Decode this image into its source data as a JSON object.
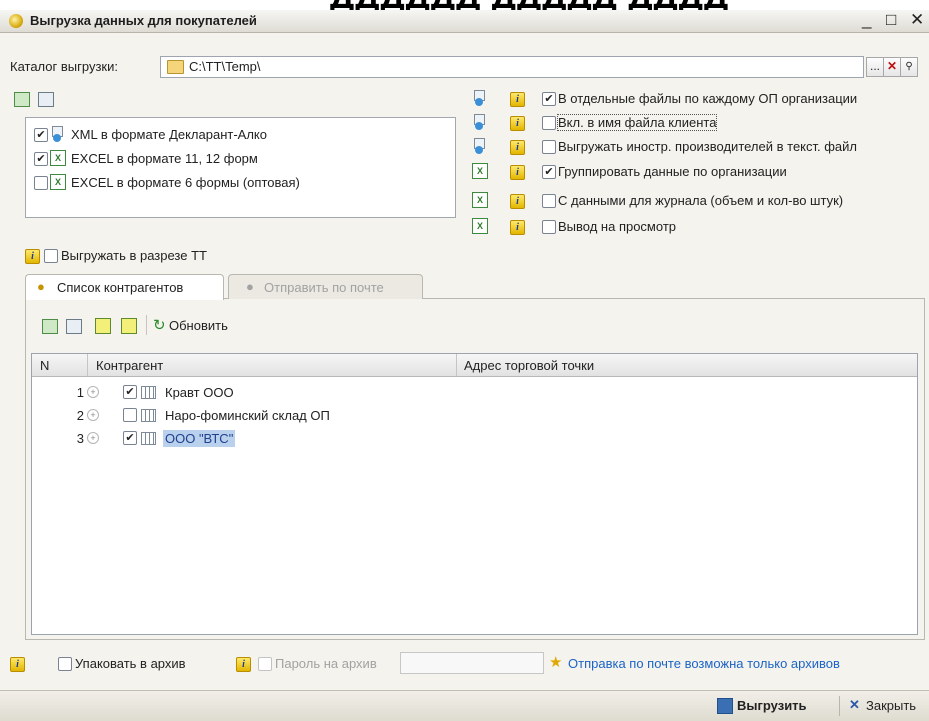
{
  "background_caption": "ДДДДДД ДДДДД ДДДД",
  "window": {
    "title": "Выгрузка данных для покупателей",
    "controls": {
      "minimize": "_",
      "maximize": "□",
      "close": "✕"
    }
  },
  "catalog": {
    "label": "Каталог выгрузки:",
    "path": "C:\\TT\\Temp\\",
    "select_btn": "...",
    "clear_btn": "✕",
    "open_btn": "🔍"
  },
  "formats": [
    {
      "label": "XML в формате Декларант-Алко",
      "checked": true,
      "icon": "xml-icon"
    },
    {
      "label": "EXCEL в формате 11, 12 форм",
      "checked": true,
      "icon": "excel-icon"
    },
    {
      "label": "EXCEL в формате 6 формы (оптовая)",
      "checked": false,
      "icon": "excel-icon"
    }
  ],
  "options": [
    {
      "label": "В отдельные файлы по каждому ОП организации",
      "checked": true,
      "icon": "xml-icon"
    },
    {
      "label": "Вкл. в имя файла клиента",
      "checked": false,
      "icon": "xml-icon"
    },
    {
      "label": "Выгружать иностр. производителей в текст. файл",
      "checked": false,
      "icon": "xml-icon"
    },
    {
      "label": "Группировать данные по организации",
      "checked": true,
      "icon": "excel-icon"
    },
    {
      "label": "С данными для журнала (объем и кол-во штук)",
      "checked": false,
      "icon": "excel-icon"
    },
    {
      "label": "Вывод на просмотр",
      "checked": false,
      "icon": "excel-icon"
    }
  ],
  "by_tt": {
    "label": "Выгружать в разрезе ТТ",
    "checked": false
  },
  "tabs": {
    "active": "Список контрагентов",
    "inactive": "Отправить по почте"
  },
  "toolbar": {
    "refresh": "Обновить"
  },
  "grid": {
    "columns": [
      "N",
      "Контрагент",
      "Адрес торговой точки"
    ],
    "rows": [
      {
        "n": "1",
        "name": "Кравт ООО",
        "checked": true,
        "selected": false
      },
      {
        "n": "2",
        "name": "Наро-фоминский склад ОП",
        "checked": false,
        "selected": false
      },
      {
        "n": "3",
        "name": "ООО \"ВТС\"",
        "checked": true,
        "selected": true
      }
    ]
  },
  "bottom": {
    "archive_label": "Упаковать в архив",
    "password_label": "Пароль на архив",
    "password_value": "",
    "mail_note": "Отправка по почте возможна только архивов"
  },
  "statusbar": {
    "export": "Выгрузить",
    "close": "Закрыть"
  }
}
